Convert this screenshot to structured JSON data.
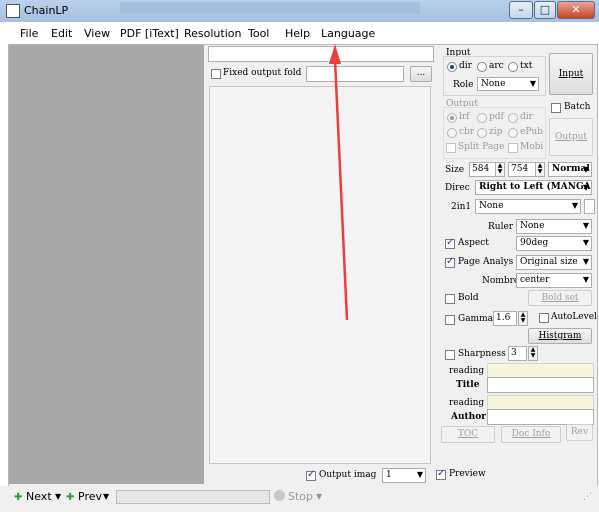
{
  "window": {
    "title": "ChainLP"
  },
  "menu": [
    "File",
    "Edit",
    "View",
    "PDF [iText]",
    "Resolution",
    "Tool",
    "Help",
    "Language"
  ],
  "center": {
    "fixed_output_label": "Fixed output fold",
    "browse_label": "...",
    "output_image_label": "Output imag",
    "output_image_value": "1"
  },
  "input_group": {
    "title": "Input",
    "radios": [
      "dir",
      "arc",
      "txt"
    ],
    "role_label": "Role",
    "role_value": "None",
    "input_button": "Input"
  },
  "output_group": {
    "title": "Output",
    "radios_row1": [
      "lrf",
      "pdf",
      "dir"
    ],
    "radios_row2": [
      "cbr",
      "zip",
      "ePub"
    ],
    "row3": [
      "Split Page",
      "Mobi"
    ],
    "batch_label": "Batch",
    "output_button": "Output"
  },
  "settings": {
    "size_label": "Size",
    "size_w": "584",
    "size_h": "754",
    "size_mode": "Normal",
    "direc_label": "Direc",
    "direc_value": "Right to Left (MANGA)",
    "twoin1_label": "2in1",
    "twoin1_value": "None",
    "ruler_label": "Ruler",
    "ruler_value": "None",
    "aspect_label": "Aspect",
    "aspect_value": "90deg",
    "page_analys_label": "Page Analys",
    "page_analys_value": "Original size",
    "nombre_label": "Nombre",
    "nombre_value": "center",
    "bold_label": "Bold",
    "bold_set_button": "Bold set",
    "gamma_label": "Gamma",
    "gamma_value": "1.6",
    "autolevel_label": "AutoLevel",
    "histgram_button": "Histgram",
    "sharpness_label": "Sharpness",
    "sharpness_value": "3",
    "reading1": "reading",
    "title_label": "Title",
    "reading2": "reading",
    "author_label": "Author",
    "toc_button": "TOC",
    "docinfo_button": "Doc Info",
    "rev_button": "Rev",
    "preview_label": "Preview"
  },
  "status": {
    "next_label": "Next",
    "prev_label": "Prev",
    "stop_label": "Stop"
  },
  "colors": {
    "arrow": "#e8413c",
    "left_pane": "#a8a8a8"
  }
}
